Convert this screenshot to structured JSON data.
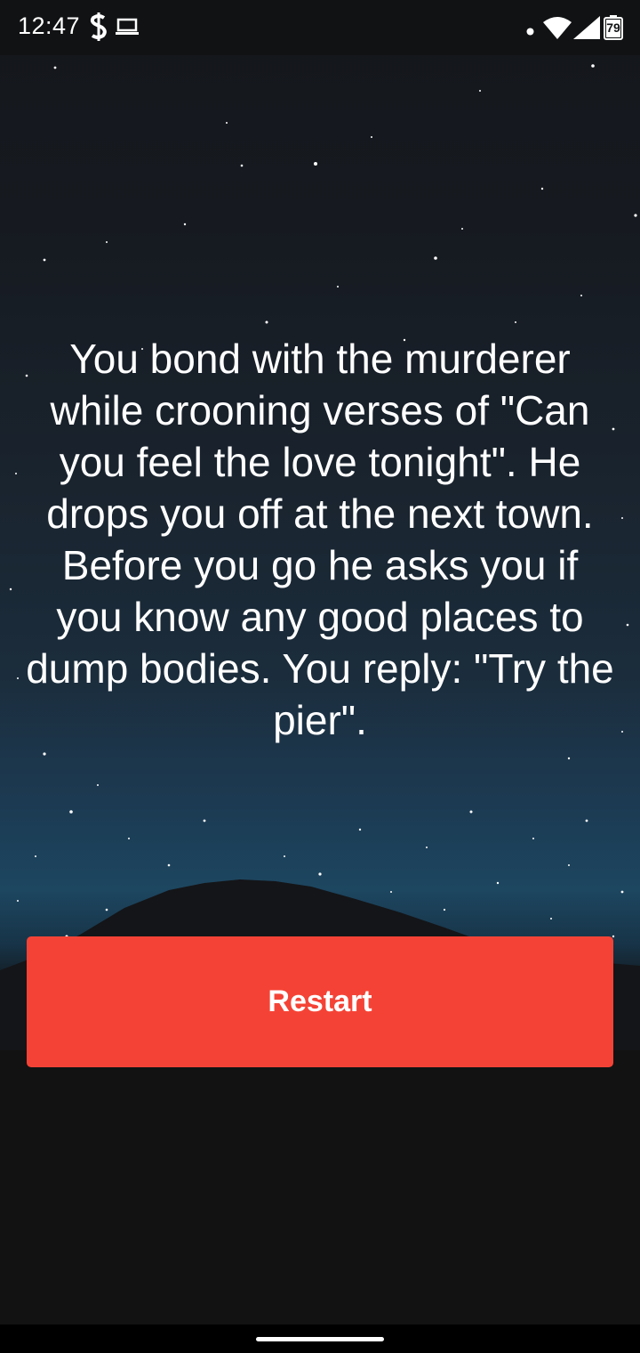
{
  "status_bar": {
    "time": "12:47",
    "battery_level": "79",
    "icons": [
      "dollar-icon",
      "laptop-icon",
      "notification-dot-icon",
      "wifi-icon",
      "signal-icon",
      "battery-icon"
    ]
  },
  "story": {
    "text": "You bond with the murderer while crooning verses of \"Can you feel the love tonight\". He drops you off at the next town. Before you go he asks you if you know any good places to dump bodies. You reply: \"Try the pier\"."
  },
  "actions": {
    "restart_label": "Restart"
  },
  "colors": {
    "button": "#f44336",
    "background": "#121212",
    "text": "#ffffff"
  }
}
